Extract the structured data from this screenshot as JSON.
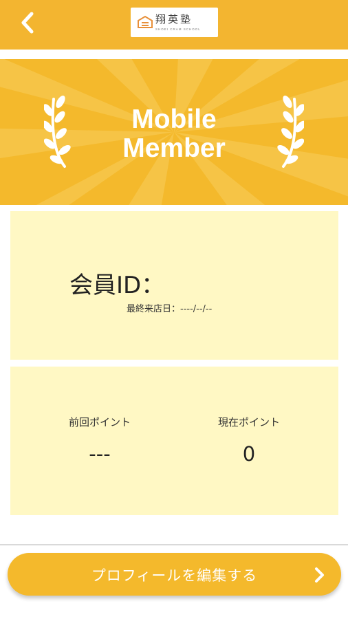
{
  "header": {
    "back_icon": "chevron-left-icon",
    "logo": {
      "name": "翔英塾",
      "subtitle": "SHOEI CRAM SCHOOL"
    }
  },
  "banner": {
    "title_line1": "Mobile",
    "title_line2": "Member",
    "decoration_icon": "laurel-icon"
  },
  "member": {
    "id_label": "会員ID：",
    "id_value": "",
    "last_visit_label": "最終来店日：",
    "last_visit_value": "----/--/--"
  },
  "points": {
    "previous_label": "前回ポイント",
    "previous_value": "---",
    "current_label": "現在ポイント",
    "current_value": "0"
  },
  "footer": {
    "edit_profile_label": "プロフィールを編集する",
    "arrow_icon": "chevron-right-icon"
  },
  "colors": {
    "accent": "#f4b92c",
    "header": "#f3b530",
    "card_background": "#fff8c4",
    "text": "#222222"
  }
}
